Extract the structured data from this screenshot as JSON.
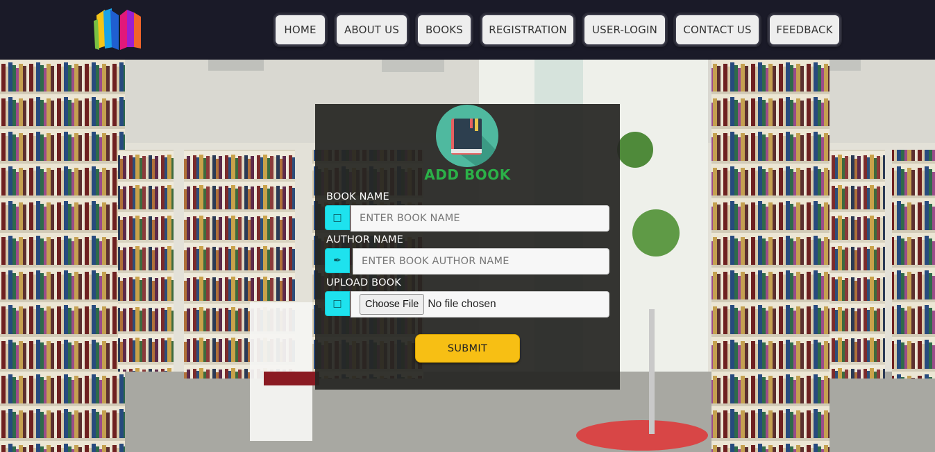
{
  "nav": {
    "items": [
      {
        "label": "HOME"
      },
      {
        "label": "ABOUT US"
      },
      {
        "label": "BOOKS"
      },
      {
        "label": "REGISTRATION"
      },
      {
        "label": "USER-LOGIN"
      },
      {
        "label": "CONTACT US"
      },
      {
        "label": "FEEDBACK"
      }
    ]
  },
  "form": {
    "title": "ADD BOOK",
    "book_name": {
      "label": "BOOK NAME",
      "placeholder": "ENTER BOOK NAME",
      "value": "",
      "icon": "book-icon"
    },
    "author_name": {
      "label": "AUTHOR NAME",
      "placeholder": "ENTER BOOK AUTHOR NAME",
      "value": "",
      "icon": "pen-icon"
    },
    "upload": {
      "label": "UPLOAD BOOK",
      "button": "Choose File",
      "status": "No file chosen",
      "icon": "upload-icon"
    },
    "submit_label": "SUBMIT"
  },
  "colors": {
    "navbar": "#1a1a28",
    "title_green": "#2bb148",
    "addon_cyan": "#1ee2ee",
    "submit_yellow": "#f7bf14",
    "badge_teal": "#4fb99f"
  }
}
